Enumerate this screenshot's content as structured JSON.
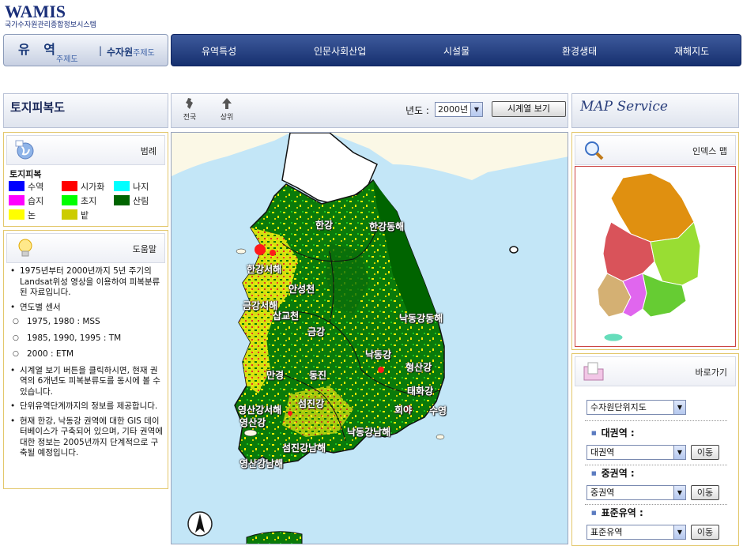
{
  "header": {
    "logo_title": "WAMIS",
    "logo_subtitle": "국가수자원관리종합정보시스템"
  },
  "tabs": {
    "basin": "유 역",
    "basin_sub": "주제도",
    "separator": "|",
    "water": "수자원",
    "water_sub": "주제도"
  },
  "nav": [
    "유역특성",
    "인문사회산업",
    "시설물",
    "환경생태",
    "재해지도"
  ],
  "left_title": "토지피복도",
  "toolbar": {
    "national": "전국",
    "up": "상위",
    "year_label": "년도 :",
    "year_value": "2000년",
    "series_button": "시계열 보기"
  },
  "right_title": "MAP Service",
  "legend": {
    "header": "범례",
    "title": "토지피복",
    "items": [
      {
        "label": "수역",
        "color": "#0000ff"
      },
      {
        "label": "시가화",
        "color": "#ff0000"
      },
      {
        "label": "나지",
        "color": "#00ffff"
      },
      {
        "label": "습지",
        "color": "#ff00ff"
      },
      {
        "label": "초지",
        "color": "#00ff00"
      },
      {
        "label": "산림",
        "color": "#006400"
      },
      {
        "label": "논",
        "color": "#ffff00"
      },
      {
        "label": "밭",
        "color": "#cccc00"
      }
    ]
  },
  "help": {
    "header": "도움말",
    "items": [
      {
        "text": "1975년부터 2000년까지 5년 주기의 Landsat위성 영상을 이용하여 피복분류된 자료입니다.",
        "sub": false
      },
      {
        "text": "연도별 센서",
        "sub": false
      },
      {
        "text": "1975, 1980 : MSS",
        "sub": true
      },
      {
        "text": "1985, 1990, 1995 : TM",
        "sub": true
      },
      {
        "text": "2000 : ETM",
        "sub": true
      },
      {
        "text": "시계열 보기 버튼을 클릭하시면, 현재 권역의 6개년도 피복분류도를 동시에 볼 수 있습니다.",
        "sub": false
      },
      {
        "text": "단위유역단계까지의 정보를 제공합니다.",
        "sub": false
      },
      {
        "text": "현재 한강, 낙동강 권역에 대한 GIS 데이터베이스가 구축되어 있으며, 기타 권역에 대한 정보는 2005년까지 단계적으로 구축될 예정입니다.",
        "sub": false
      }
    ]
  },
  "map_labels": [
    "한강",
    "한강동해",
    "한강서해",
    "안성천",
    "금강서해",
    "삽교천",
    "금강",
    "낙동강동해",
    "낙동강",
    "형산강",
    "만경",
    "동진",
    "태화강",
    "영산강서해",
    "섬진강",
    "회야",
    "수영",
    "영산강",
    "낙동강남해",
    "섬진강남해",
    "영산강남해"
  ],
  "index_map": {
    "header": "인덱스 맵",
    "colors": {
      "north": "#e09010",
      "west": "#d9535a",
      "east": "#99dd33",
      "southwest": "#d4b073",
      "south": "#e066ee",
      "southeast": "#66cc33",
      "jeju": "#66ddbb"
    }
  },
  "goto": {
    "header": "바로가기",
    "top_select": "수자원단위지도",
    "sections": [
      {
        "title": "대권역 :",
        "select": "대권역",
        "button": "이동"
      },
      {
        "title": "중권역 :",
        "select": "중권역",
        "button": "이동"
      },
      {
        "title": "표준유역 :",
        "select": "표준유역",
        "button": "이동"
      }
    ]
  }
}
